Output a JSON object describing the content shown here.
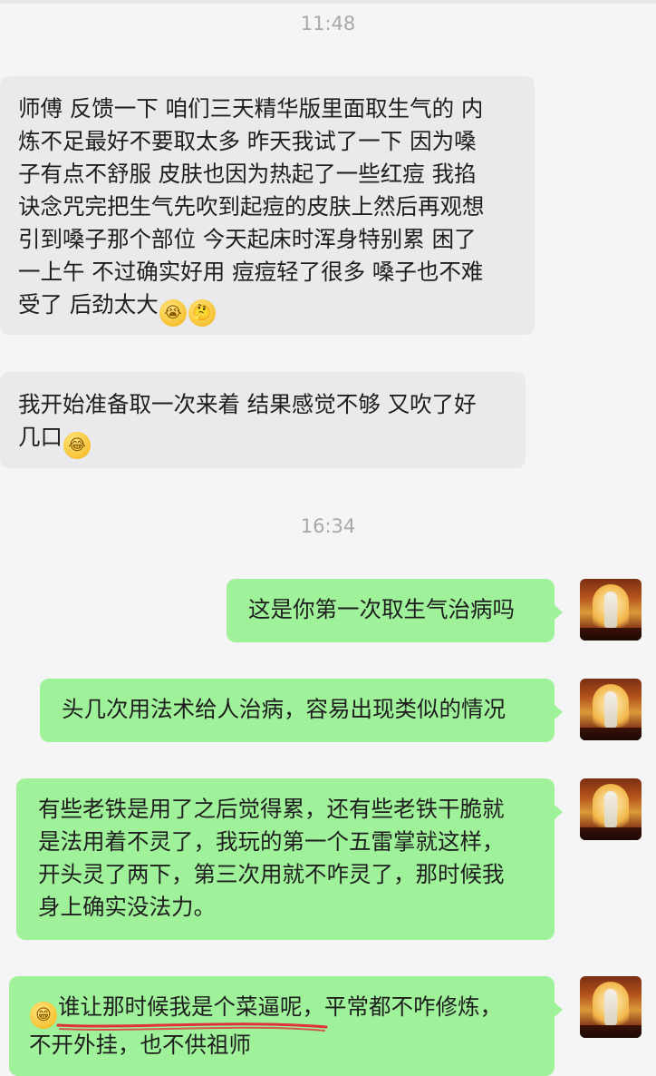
{
  "timestamps": [
    "11:48",
    "16:34"
  ],
  "messages": {
    "m1": {
      "p1": "师傅 反馈一下 咱们三天精华版里面取生气的 内",
      "p2": "炼不足最好不要取太多 昨天我试了一下 因为嗓",
      "p3": "子有点不舒服 皮肤也因为热起了一些红痘 我掐",
      "p4": "诀念咒完把生气先吹到起痘的皮肤上然后再观想",
      "p5": "引到嗓子那个部位 今天起床时浑身特别累 困了",
      "p6": "一上午 不过确实好用 痘痘轻了很多 嗓子也不难",
      "p7": "受了 后劲太大",
      "emoji_a": "crying-face-emoji",
      "emoji_b": "thinking-face-emoji"
    },
    "m2": {
      "p1": "我开始准备取一次来着 结果感觉不够 又吹了好",
      "p2": "几口",
      "emoji": "crying-laughing-emoji"
    },
    "m3": {
      "text": "这是你第一次取生气治病吗"
    },
    "m4": {
      "text": "头几次用法术给人治病，容易出现类似的情况"
    },
    "m5": {
      "p1": "有些老铁是用了之后觉得累，还有些老铁干脆就",
      "p2": "是法用着不灵了，我玩的第一个五雷掌就这样，",
      "p3": "开头灵了两下，第三次用就不咋灵了，那时候我",
      "p4": "身上确实没法力。"
    },
    "m6": {
      "emoji": "grinning-face-emoji",
      "highlight": "谁让那时候我是个菜逼呢",
      "rest": "，平常都不咋修炼，",
      "p2": "不开外挂，也不供祖师"
    }
  },
  "colors": {
    "incoming_bubble": "#eaeaec",
    "outgoing_bubble": "#9ff29a",
    "underline": "#e0303a"
  }
}
